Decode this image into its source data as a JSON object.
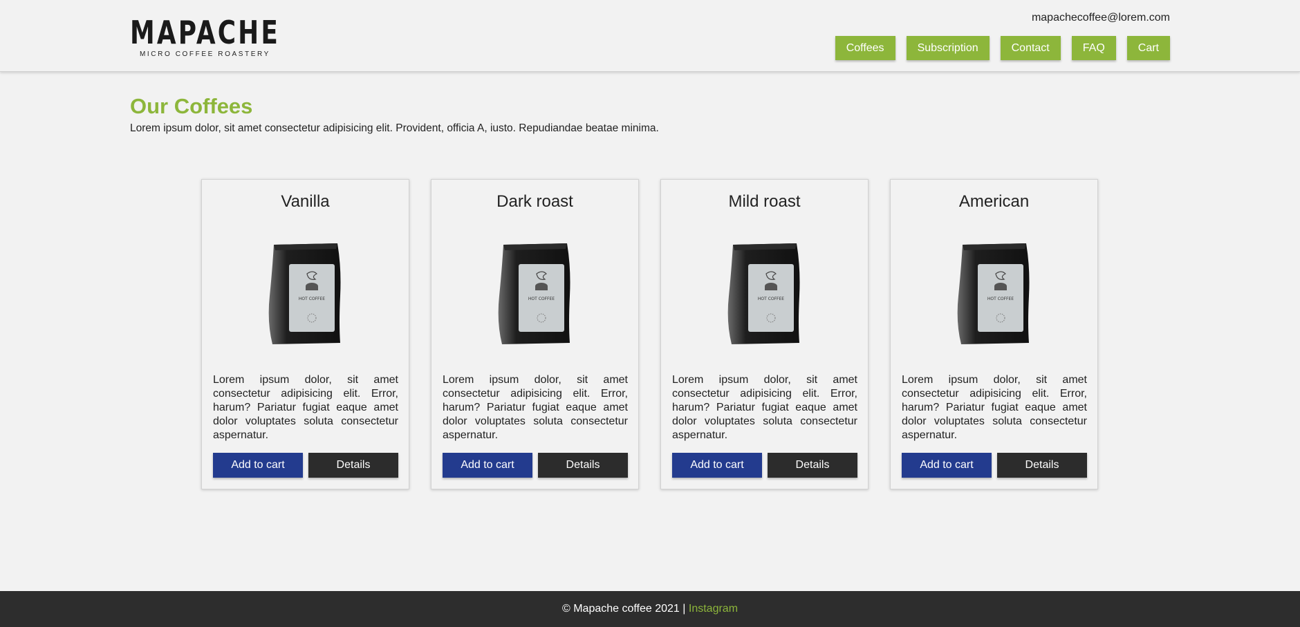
{
  "header": {
    "logo_text": "MAPACHE",
    "logo_tagline": "MICRO COFFEE ROASTERY",
    "email": "mapachecoffee@lorem.com",
    "nav": [
      "Coffees",
      "Subscription",
      "Contact",
      "FAQ",
      "Cart"
    ]
  },
  "main": {
    "title": "Our Coffees",
    "intro": "Lorem ipsum dolor, sit amet consectetur adipisicing elit. Provident, officia A, iusto. Repudiandae beatae minima."
  },
  "products": [
    {
      "name": "Vanilla",
      "description": "Lorem ipsum dolor, sit amet consectetur adipisicing elit. Error, harum? Pariatur fugiat eaque amet dolor voluptates soluta consectetur aspernatur.",
      "add_label": "Add to cart",
      "details_label": "Details",
      "bag_label": "HOT COFFEE"
    },
    {
      "name": "Dark roast",
      "description": "Lorem ipsum dolor, sit amet consectetur adipisicing elit. Error, harum? Pariatur fugiat eaque amet dolor voluptates soluta consectetur aspernatur.",
      "add_label": "Add to cart",
      "details_label": "Details",
      "bag_label": "HOT COFFEE"
    },
    {
      "name": "Mild roast",
      "description": "Lorem ipsum dolor, sit amet consectetur adipisicing elit. Error, harum? Pariatur fugiat eaque amet dolor voluptates soluta consectetur aspernatur.",
      "add_label": "Add to cart",
      "details_label": "Details",
      "bag_label": "HOT COFFEE"
    },
    {
      "name": "American",
      "description": "Lorem ipsum dolor, sit amet consectetur adipisicing elit. Error, harum? Pariatur fugiat eaque amet dolor voluptates soluta consectetur aspernatur.",
      "add_label": "Add to cart",
      "details_label": "Details",
      "bag_label": "HOT COFFEE"
    }
  ],
  "footer": {
    "copyright": "© Mapache coffee 2021 |",
    "instagram_label": "Instagram"
  },
  "colors": {
    "accent": "#8db63b",
    "primary_button": "#233b8e",
    "dark_button": "#2c2c2c",
    "footer_bg": "#2d2d2d",
    "background": "#f2f2f2"
  },
  "icons": {
    "product_image": "coffee-bag-icon"
  }
}
